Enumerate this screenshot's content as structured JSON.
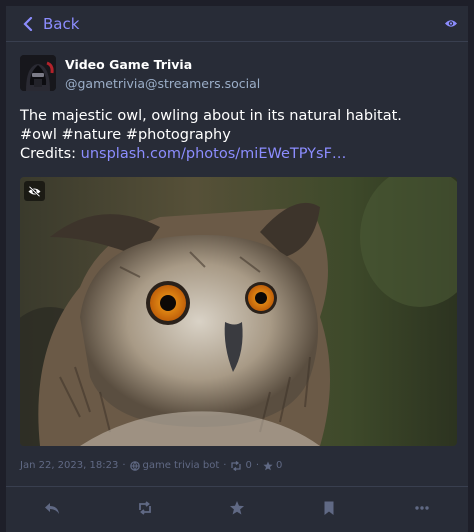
{
  "header": {
    "back_label": "Back"
  },
  "account": {
    "display_name": "Video Game Trivia",
    "handle": "@gametrivia@streamers.social"
  },
  "status": {
    "text_line1": "The majestic owl, owling about in its natural habitat.",
    "hashtags": "#owl #nature #photography",
    "credits_label": "Credits: ",
    "credits_link": "unsplash.com/photos/miEWeTPYsF…"
  },
  "meta": {
    "timestamp": "Jan 22, 2023, 18:23",
    "sep1": "·",
    "application": "game trivia bot",
    "sep2": "·",
    "boosts": "0",
    "sep3": "·",
    "favourites": "0"
  },
  "colors": {
    "accent": "#8c8dff",
    "background": "#282c37",
    "muted": "#606984"
  },
  "icons": {
    "back": "chevron-left-icon",
    "visibility": "eye-icon",
    "media_toggle": "eye-slash-icon",
    "reply": "reply-icon",
    "boost": "retweet-icon",
    "favourite": "star-icon",
    "bookmark": "bookmark-icon",
    "more": "ellipsis-icon"
  }
}
